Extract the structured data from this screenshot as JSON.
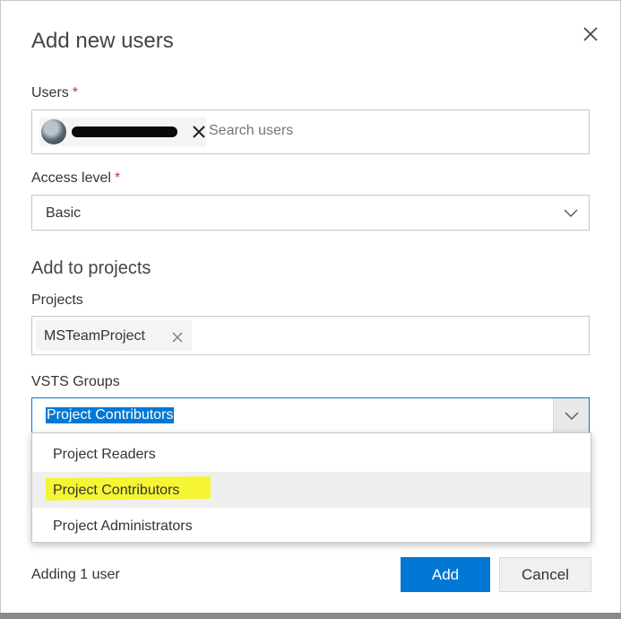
{
  "dialog": {
    "title": "Add new users"
  },
  "users": {
    "label": "Users",
    "required_mark": "*",
    "search_placeholder": "Search users"
  },
  "access_level": {
    "label": "Access level",
    "required_mark": "*",
    "value": "Basic"
  },
  "add_to_projects": {
    "heading": "Add to projects",
    "projects_label": "Projects",
    "project_chip": "MSTeamProject"
  },
  "vsts_groups": {
    "label": "VSTS Groups",
    "value": "Project Contributors",
    "options": [
      {
        "label": "Project Readers"
      },
      {
        "label": "Project Contributors"
      },
      {
        "label": "Project Administrators"
      }
    ]
  },
  "footer": {
    "status": "Adding 1 user",
    "add_label": "Add",
    "cancel_label": "Cancel"
  },
  "colors": {
    "accent": "#0078d4",
    "required": "#c4314b",
    "annotation_highlight": "#f5f534"
  },
  "icons": {
    "close": "close-icon",
    "remove_chip": "close-icon",
    "dropdown": "chevron-down-icon"
  }
}
